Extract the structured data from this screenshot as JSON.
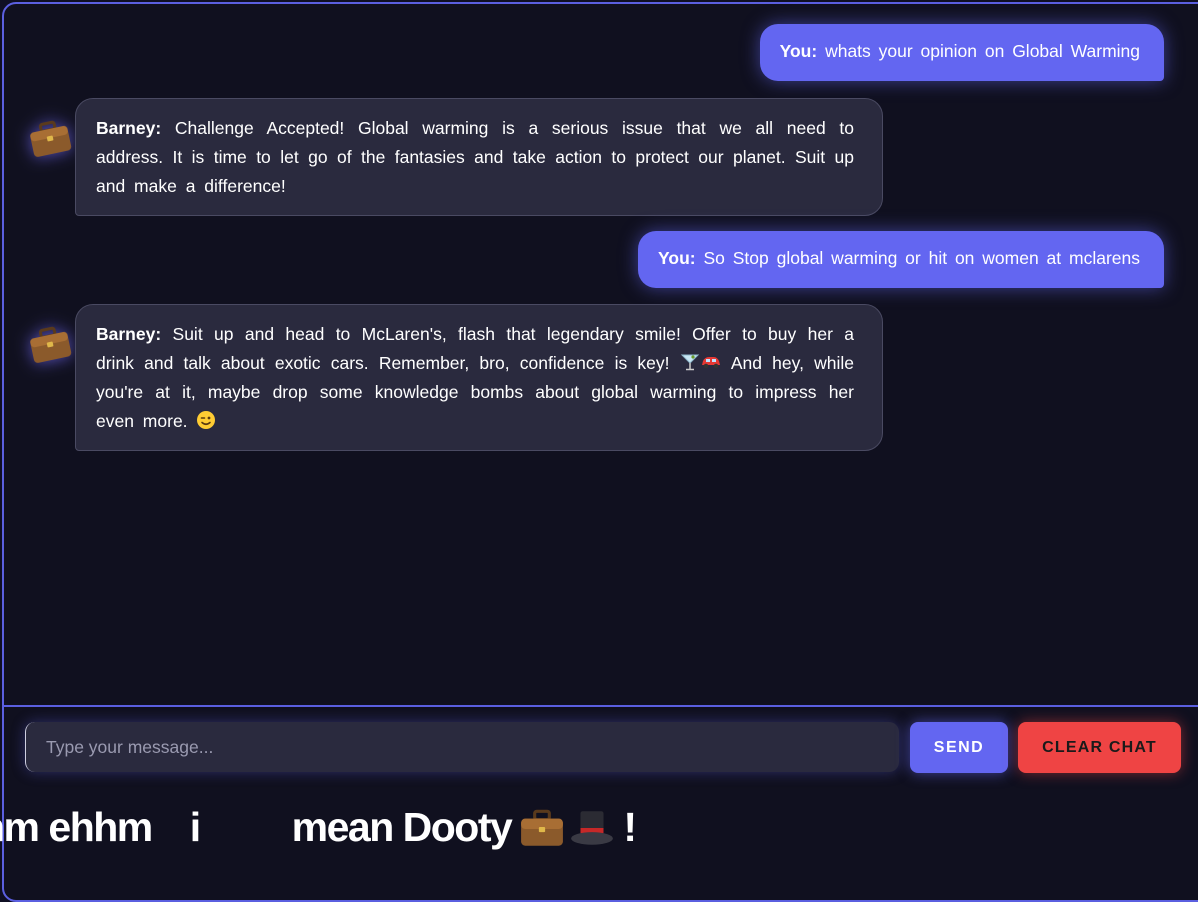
{
  "chat": {
    "messages": [
      {
        "role": "user",
        "speaker": "You:",
        "text": "whats your opinion on Global Warming"
      },
      {
        "role": "bot",
        "speaker": "Barney:",
        "avatar_icon": "briefcase-icon",
        "text": "Challenge Accepted! Global warming is a serious issue that we all need to address. It is time to let go of the fantasies and take action to protect our planet. Suit up and make a difference!"
      },
      {
        "role": "user",
        "speaker": "You:",
        "text": "So Stop global warming or hit on women at mclarens"
      },
      {
        "role": "bot",
        "speaker": "Barney:",
        "avatar_icon": "briefcase-icon",
        "text_before_emoji": "Suit up and head to McLaren's, flash that legendary smile! Offer to buy her a drink and talk about exotic cars. Remember, bro, confidence is key! ",
        "inline_emojis": [
          "cocktail-icon",
          "car-icon"
        ],
        "text_after_emoji": " And hey, while you're at it, maybe drop some knowledge bombs about global warming to impress her even more. ",
        "trailing_emoji": "winking-face-icon"
      }
    ]
  },
  "composer": {
    "placeholder": "Type your message...",
    "value": "",
    "send_label": "SEND",
    "clear_label": "CLEAR CHAT"
  },
  "banner": {
    "word1": "hm ehhm",
    "word2": "i",
    "word3": "mean Dooty",
    "emojis": [
      "briefcase-icon",
      "top-hat-icon"
    ],
    "suffix": "!"
  },
  "colors": {
    "accent": "#6366f1",
    "danger": "#ef4444",
    "background": "#10101f",
    "bot_bubble": "#2a2a3e",
    "border": "#5b5fe0"
  }
}
